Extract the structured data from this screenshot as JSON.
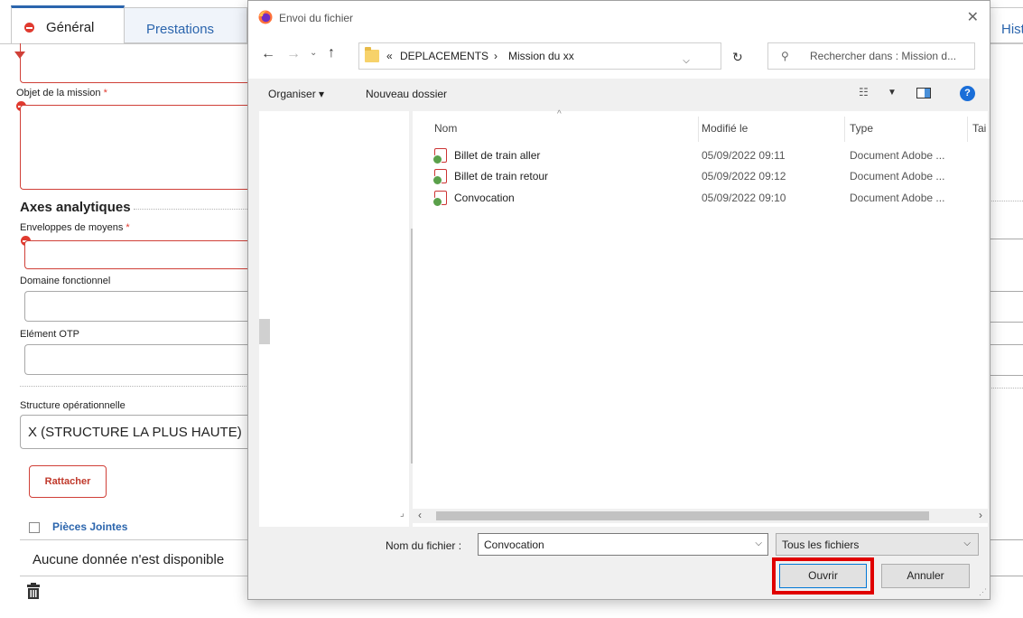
{
  "background_form": {
    "tabs": [
      {
        "label": "Général"
      },
      {
        "label": "Prestations"
      },
      {
        "label": "Hist"
      }
    ],
    "objet_label": "Objet de la mission",
    "required_mark": "*",
    "axes_title": "Axes analytiques",
    "enveloppes_label": "Enveloppes de moyens",
    "domaine_label": "Domaine fonctionnel",
    "element_otp_label": "Elément OTP",
    "structure_label": "Structure opérationnelle",
    "structure_value": "X (STRUCTURE LA PLUS HAUTE)",
    "rattacher_label": "Rattacher",
    "pieces_jointes_label": "Pièces Jointes",
    "no_data_text": "Aucune donnée n'est disponible"
  },
  "dialog": {
    "title": "Envoi du fichier",
    "breadcrumb": {
      "prefix": "«",
      "items": [
        "DEPLACEMENTS",
        "Mission du xx"
      ],
      "separator": "›"
    },
    "search_placeholder": "Rechercher dans : Mission d...",
    "toolbar": {
      "organiser": "Organiser ▾",
      "nouveau_dossier": "Nouveau dossier"
    },
    "columns": {
      "name": "Nom",
      "modified": "Modifié le",
      "type": "Type",
      "size": "Tai"
    },
    "files": [
      {
        "name": "Billet de train aller",
        "modified": "05/09/2022 09:11",
        "type": "Document Adobe ..."
      },
      {
        "name": "Billet de train retour",
        "modified": "05/09/2022 09:12",
        "type": "Document Adobe ..."
      },
      {
        "name": "Convocation",
        "modified": "05/09/2022 09:10",
        "type": "Document Adobe ..."
      }
    ],
    "filename_label": "Nom du fichier :",
    "filename_value": "Convocation",
    "filetype_value": "Tous les fichiers",
    "open_label": "Ouvrir",
    "cancel_label": "Annuler"
  },
  "colors": {
    "accent_blue": "#2b65ad",
    "error_red": "#e03a2f",
    "highlight_red": "#e00000",
    "windows_blue": "#0078d7"
  }
}
